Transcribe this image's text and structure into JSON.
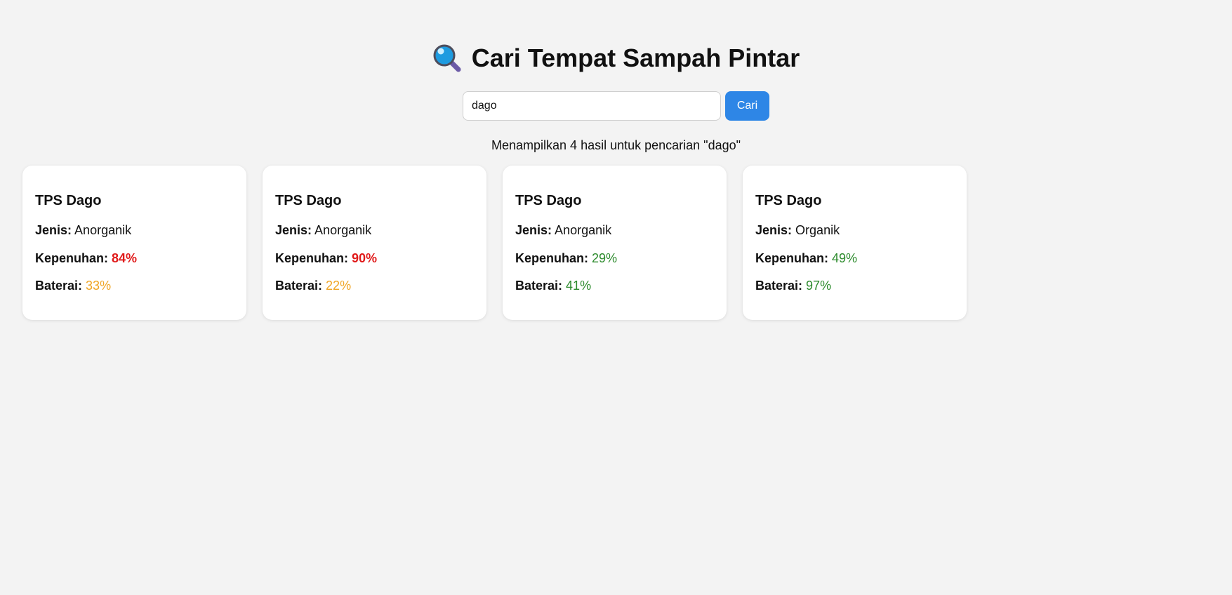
{
  "header": {
    "title": "Cari Tempat Sampah Pintar",
    "icon": "magnifying-glass-icon"
  },
  "search": {
    "value": "dago",
    "button_label": "Cari"
  },
  "result_text": "Menampilkan 4 hasil untuk pencarian \"dago\"",
  "colors": {
    "accent": "#2e86e6",
    "red": "#e01a1a",
    "orange": "#f0a422",
    "green": "#2b8a2b",
    "background": "#f3f3f3"
  },
  "labels": {
    "type": "Jenis:",
    "fullness": "Kepenuhan:",
    "battery": "Baterai:"
  },
  "cards": [
    {
      "name": "TPS Dago",
      "type": "Anorganik",
      "fullness": "84%",
      "battery": "33%"
    },
    {
      "name": "TPS Dago",
      "type": "Anorganik",
      "fullness": "90%",
      "battery": "22%"
    },
    {
      "name": "TPS Dago",
      "type": "Anorganik",
      "fullness": "29%",
      "battery": "41%"
    },
    {
      "name": "TPS Dago",
      "type": "Organik",
      "fullness": "49%",
      "battery": "97%"
    }
  ]
}
